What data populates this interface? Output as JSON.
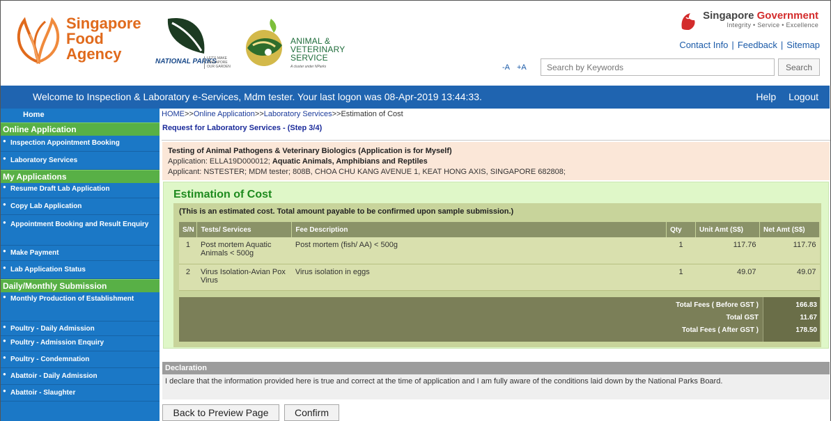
{
  "header": {
    "sfa_lines": [
      "Singapore",
      "Food",
      "Agency"
    ],
    "np_word": "NATIONAL PARKS",
    "np_sub": [
      "LET'S MAKE",
      "SINGAPORE",
      "OUR GARDEN"
    ],
    "avs_lines": [
      "ANIMAL &",
      "VETERINARY",
      "SERVICE"
    ],
    "avs_cluster": "A cluster under NParks",
    "gov_title_a": "Singapore ",
    "gov_title_b": "Government",
    "gov_sub": "Integrity • Service • Excellence",
    "links": [
      "Contact Info",
      "Feedback",
      "Sitemap"
    ],
    "font_small": "-A",
    "font_large": "+A",
    "search_placeholder": "Search by Keywords",
    "search_button": "Search"
  },
  "welcome": {
    "message": "Welcome to Inspection & Laboratory e-Services, Mdm tester. Your last logon was 08-Apr-2019 13:44:33.",
    "help": "Help",
    "logout": "Logout"
  },
  "sidebar": {
    "home": "Home",
    "sections": [
      {
        "title": "Online Application",
        "items": [
          "Inspection Appointment Booking",
          "Laboratory Services"
        ]
      },
      {
        "title": "My Applications",
        "items": [
          "Resume Draft Lab Application",
          "Copy Lab Application",
          "Appointment Booking and Result Enquiry",
          "Make Payment",
          "Lab Application Status"
        ]
      },
      {
        "title": "Daily/Monthly Submission",
        "items": [
          "Monthly Production of Establishment",
          "Poultry - Daily Admission",
          "Poultry - Admission Enquiry",
          "Poultry - Condemnation",
          "Abattoir - Daily Admission",
          "Abattoir - Slaughter"
        ]
      }
    ]
  },
  "breadcrumb": {
    "home": "HOME",
    "sep": ">>",
    "online": "Online Application",
    "lab": "Laboratory Services",
    "current": "Estimation of Cost"
  },
  "step_title": "Request for Laboratory Services - (Step 3/4)",
  "app_info": {
    "title": "Testing of Animal Pathogens & Veterinary Biologics (Application is for Myself)",
    "application_label": "Application: ELLA19D000012; ",
    "application_type": "Aquatic Animals, Amphibians and Reptiles",
    "applicant": "Applicant: NSTESTER; MDM tester; 808B, CHOA CHU KANG AVENUE 1, KEAT HONG AXIS, SINGAPORE 682808;"
  },
  "estimation": {
    "title": "Estimation of Cost",
    "note": "(This is an estimated cost. Total amount payable to be confirmed upon sample submission.)",
    "columns": [
      "S/N",
      "Tests/ Services",
      "Fee Description",
      "Qty",
      "Unit Amt (S$)",
      "Net Amt (S$)"
    ],
    "rows": [
      {
        "sn": "1",
        "service": "Post mortem Aquatic Animals < 500g",
        "fee": "Post mortem (fish/ AA) < 500g",
        "qty": "1",
        "unit": "117.76",
        "net": "117.76"
      },
      {
        "sn": "2",
        "service": "Virus Isolation-Avian Pox Virus",
        "fee": "Virus isolation in eggs",
        "qty": "1",
        "unit": "49.07",
        "net": "49.07"
      }
    ],
    "totals": [
      {
        "label": "Total Fees ( Before GST )",
        "value": "166.83"
      },
      {
        "label": "Total GST",
        "value": "11.67"
      },
      {
        "label": "Total Fees ( After GST )",
        "value": "178.50"
      }
    ]
  },
  "declaration": {
    "heading": "Declaration",
    "text": "I declare that the information provided here is true and correct at the time of application and I am fully aware of the conditions laid down by the National Parks Board."
  },
  "buttons": {
    "back": "Back to Preview Page",
    "confirm": "Confirm"
  },
  "colors": {
    "welcome_bar": "#1f64b0",
    "sidebar": "#1b78c6",
    "sidebar_section": "#58b046",
    "estimation_title": "#1e8a1e"
  }
}
